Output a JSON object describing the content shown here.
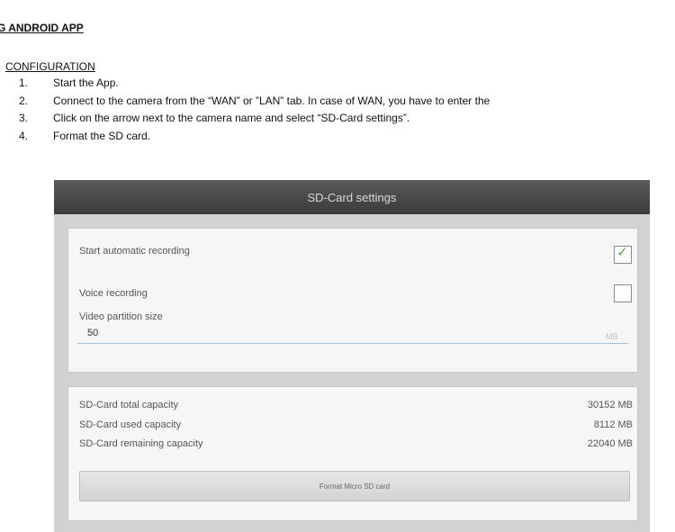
{
  "document": {
    "heading": "G ANDROID APP ",
    "subheading": " CONFIGURATION",
    "steps": [
      {
        "number": "1.",
        "text": "Start the App."
      },
      {
        "number": "2.",
        "text": "Connect to the camera from the “WAN” or ”LAN” tab. In case of WAN, you have to enter the"
      },
      {
        "number": "3.",
        "text": "Click on the arrow next to the camera name and select “SD-Card settings”."
      },
      {
        "number": "4.",
        "text": "Format the SD card."
      }
    ]
  },
  "screen": {
    "title": "SD-Card settings",
    "recording": {
      "auto_recording_label": "Start automatic recording",
      "auto_recording_checked": true,
      "voice_recording_label": "Voice recording",
      "voice_recording_checked": false,
      "partition_label": "Video partition size",
      "partition_value": "50",
      "partition_unit": "MB"
    },
    "capacity": {
      "total_label": "SD-Card total capacity",
      "total_value": "30152 MB",
      "used_label": "SD-Card used capacity",
      "used_value": "8112 MB",
      "remaining_label": "SD-Card remaining capacity",
      "remaining_value": "22040 MB"
    },
    "format_button_label": "Format Micro SD card"
  }
}
